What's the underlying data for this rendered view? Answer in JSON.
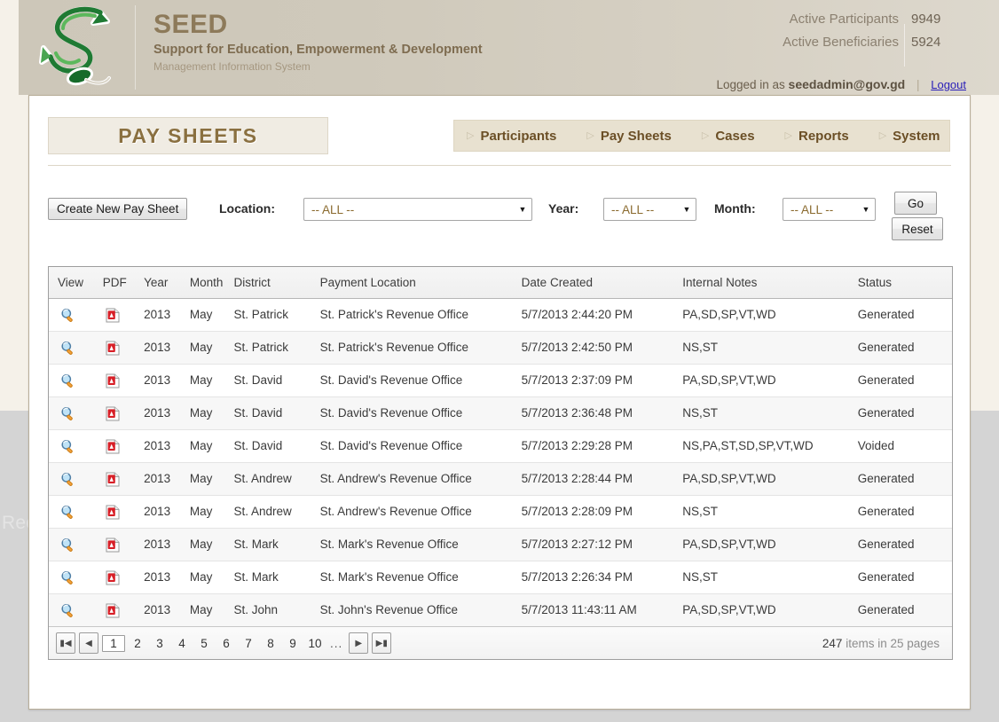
{
  "brand": {
    "title": "SEED",
    "subtitle": "Support for Education, Empowerment & Development",
    "tagline": "Management Information System",
    "logo_icon": "seed-snake-logo"
  },
  "header": {
    "stats": [
      {
        "label": "Active Participants",
        "value": "9949"
      },
      {
        "label": "Active Beneficiaries",
        "value": "5924"
      }
    ],
    "logged_in_prefix": "Logged in as",
    "username": "seedadmin@gov.gd",
    "separator": "|",
    "logout_label": "Logout"
  },
  "page": {
    "title": "PAY SHEETS",
    "watermark": "Rectangular Snip"
  },
  "nav": {
    "items": [
      {
        "label": "Participants",
        "icon": "triangle-right-icon"
      },
      {
        "label": "Pay Sheets",
        "icon": "triangle-right-icon"
      },
      {
        "label": "Cases",
        "icon": "triangle-right-icon"
      },
      {
        "label": "Reports",
        "icon": "triangle-right-icon"
      },
      {
        "label": "System",
        "icon": "triangle-right-icon"
      }
    ]
  },
  "filters": {
    "create_button": "Create New Pay Sheet",
    "location_label": "Location:",
    "location_value": "-- ALL --",
    "year_label": "Year:",
    "year_value": "-- ALL --",
    "month_label": "Month:",
    "month_value": "-- ALL --",
    "go_button": "Go",
    "reset_button": "Reset"
  },
  "grid": {
    "columns": [
      "View",
      "PDF",
      "Year",
      "Month",
      "District",
      "Payment Location",
      "Date Created",
      "Internal Notes",
      "Status"
    ],
    "view_icon": "magnifier-icon",
    "pdf_icon": "pdf-file-icon",
    "rows": [
      {
        "year": "2013",
        "month": "May",
        "district": "St. Patrick",
        "location": "St. Patrick's Revenue Office",
        "created": "5/7/2013 2:44:20 PM",
        "notes": "PA,SD,SP,VT,WD",
        "status": "Generated"
      },
      {
        "year": "2013",
        "month": "May",
        "district": "St. Patrick",
        "location": "St. Patrick's Revenue Office",
        "created": "5/7/2013 2:42:50 PM",
        "notes": "NS,ST",
        "status": "Generated"
      },
      {
        "year": "2013",
        "month": "May",
        "district": "St. David",
        "location": "St. David's Revenue Office",
        "created": "5/7/2013 2:37:09 PM",
        "notes": "PA,SD,SP,VT,WD",
        "status": "Generated"
      },
      {
        "year": "2013",
        "month": "May",
        "district": "St. David",
        "location": "St. David's Revenue Office",
        "created": "5/7/2013 2:36:48 PM",
        "notes": "NS,ST",
        "status": "Generated"
      },
      {
        "year": "2013",
        "month": "May",
        "district": "St. David",
        "location": "St. David's Revenue Office",
        "created": "5/7/2013 2:29:28 PM",
        "notes": "NS,PA,ST,SD,SP,VT,WD",
        "status": "Voided"
      },
      {
        "year": "2013",
        "month": "May",
        "district": "St. Andrew",
        "location": "St. Andrew's Revenue Office",
        "created": "5/7/2013 2:28:44 PM",
        "notes": "PA,SD,SP,VT,WD",
        "status": "Generated"
      },
      {
        "year": "2013",
        "month": "May",
        "district": "St. Andrew",
        "location": "St. Andrew's Revenue Office",
        "created": "5/7/2013 2:28:09 PM",
        "notes": "NS,ST",
        "status": "Generated"
      },
      {
        "year": "2013",
        "month": "May",
        "district": "St. Mark",
        "location": "St. Mark's Revenue Office",
        "created": "5/7/2013 2:27:12 PM",
        "notes": "PA,SD,SP,VT,WD",
        "status": "Generated"
      },
      {
        "year": "2013",
        "month": "May",
        "district": "St. Mark",
        "location": "St. Mark's Revenue Office",
        "created": "5/7/2013 2:26:34 PM",
        "notes": "NS,ST",
        "status": "Generated"
      },
      {
        "year": "2013",
        "month": "May",
        "district": "St. John",
        "location": "St. John's Revenue Office",
        "created": "5/7/2013 11:43:11 AM",
        "notes": "PA,SD,SP,VT,WD",
        "status": "Generated"
      }
    ]
  },
  "pager": {
    "first_icon": "skip-first-icon",
    "prev_icon": "arrow-left-icon",
    "next_icon": "arrow-right-icon",
    "last_icon": "skip-last-icon",
    "pages": [
      "1",
      "2",
      "3",
      "4",
      "5",
      "6",
      "7",
      "8",
      "9",
      "10"
    ],
    "current_page": "1",
    "ellipsis": "...",
    "item_count": "247",
    "info_suffix": " items in 25 pages"
  }
}
